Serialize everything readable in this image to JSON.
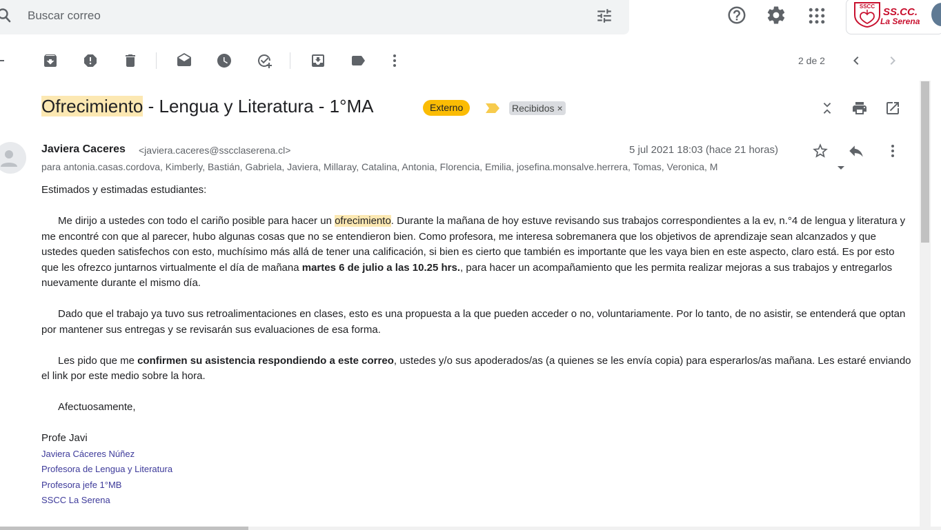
{
  "search": {
    "placeholder": "Buscar correo"
  },
  "account": {
    "logo_badge": "SSCC",
    "logo_line1": "SS.CC.",
    "logo_line2": "La Serena"
  },
  "toolbar": {
    "page_count": "2 de 2"
  },
  "email": {
    "subject_highlight": "Ofrecimiento",
    "subject_rest": " - Lengua y Literatura - 1°MA",
    "badge": "Externo",
    "label": "Recibidos",
    "label_close": "×",
    "sender_name": "Javiera Caceres",
    "sender_email": "<javiera.caceres@sscclaserena.cl>",
    "date": "5 jul 2021 18:03 (hace 21 horas)",
    "recipients": "para antonia.casas.cordova, Kimberly, Bastián, Gabriela, Javiera, Millaray, Catalina, Antonia, Florencia, Emilia, josefina.monsalve.herrera, Tomas, Veronica, M"
  },
  "body": {
    "greeting": "Estimados y estimadas estudiantes:",
    "p1_a": "Me dirijo a ustedes con todo el cariño posible para hacer un ",
    "p1_hl": "ofrecimiento",
    "p1_b": ". Durante la mañana de hoy estuve revisando sus trabajos correspondientes a la ev, n.°4 de lengua y literatura y me encontré con que al parecer, hubo algunas cosas que no se entendieron bien. Como profesora, me interesa sobremanera que los objetivos de aprendizaje sean alcanzados y que ustedes queden satisfechos con esto, muchísimo más allá de tener una calificación, si bien es cierto que también es importante que les vaya bien en este aspecto, claro está. Es por esto que les ofrezco juntarnos virtualmente el día de mañana ",
    "p1_bold": "martes 6 de julio a las 10.25 hrs.",
    "p1_c": ", para hacer un acompañamiento que les permita realizar mejoras a sus trabajos y entregarlos nuevamente durante el mismo día.",
    "p2": "Dado que el trabajo ya tuvo sus retroalimentaciones en clases, esto es una propuesta a la que pueden acceder o no, voluntariamente. Por lo tanto, de no asistir, se entenderá que optan por mantener sus entregas y se revisarán sus evaluaciones de esa forma.",
    "p3_a": "Les pido que me ",
    "p3_bold": "confirmen su asistencia respondiendo a este correo",
    "p3_b": ", ustedes y/o sus apoderados/as (a quienes se les envía copia) para esperarlos/as mañana. Les estaré enviando el link por este medio sobre la hora.",
    "closing": "Afectuosamente,",
    "sign_name": "Profe Javi",
    "sig_lines": [
      "Javiera Cáceres Núñez",
      "Profesora de Lengua y Literatura",
      "Profesora jefe 1°MB",
      "SSCC La Serena"
    ]
  },
  "colors": {
    "badge": "#fbbc04",
    "highlight": "#fce8b2",
    "signature": "#3d3a9a",
    "logo": "#c8102e"
  }
}
